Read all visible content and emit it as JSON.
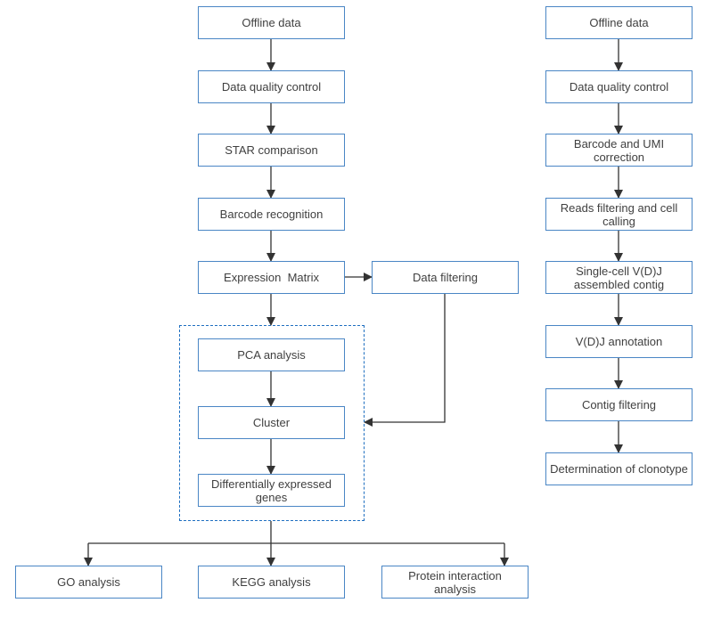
{
  "left_flow": {
    "steps": [
      "Offline data",
      "Data quality control",
      "STAR comparison",
      "Barcode recognition",
      "Expression  Matrix"
    ],
    "side_step": "Data filtering",
    "group": [
      "PCA analysis",
      "Cluster",
      "Differentially expressed genes"
    ],
    "outputs": [
      "GO analysis",
      "KEGG analysis",
      "Protein interaction analysis"
    ]
  },
  "right_flow": {
    "steps": [
      "Offline data",
      "Data quality control",
      "Barcode and UMI correction",
      "Reads filtering and cell calling",
      "Single-cell V(D)J assembled contig",
      "V(D)J annotation",
      "Contig filtering",
      "Determination of clonotype"
    ]
  },
  "colors": {
    "box_border": "#4a86c5",
    "group_border": "#1f6fc0",
    "arrow": "#404040",
    "text": "#404040"
  }
}
